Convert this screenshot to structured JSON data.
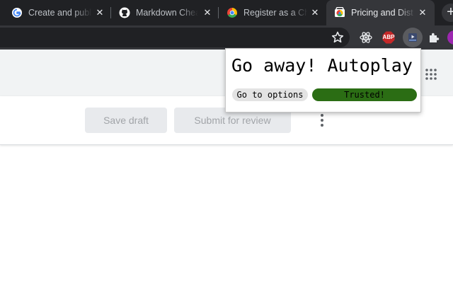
{
  "browser": {
    "tabs": [
      {
        "title": "Create and publ",
        "favicon": "google-g-icon",
        "active": false
      },
      {
        "title": "Markdown Chea",
        "favicon": "github-icon",
        "active": false
      },
      {
        "title": "Register as a Ch",
        "favicon": "chrome-icon",
        "active": false
      },
      {
        "title": "Pricing and Dist",
        "favicon": "webstore-icon",
        "active": true
      }
    ],
    "new_tab_label": "+",
    "close_label": "✕",
    "toolbar": {
      "bookmark_icon": "star-icon",
      "extensions": [
        {
          "name": "react-devtools-icon"
        },
        {
          "name": "adblock-plus-icon",
          "label": "ABP"
        },
        {
          "name": "autoplay-extension-icon"
        },
        {
          "name": "puzzle-extensions-icon"
        }
      ],
      "profile_icon": "avatar"
    }
  },
  "page": {
    "save_draft_label": "Save draft",
    "submit_label": "Submit for review",
    "more_icon": "more-vert-icon",
    "apps_icon": "apps-grid-icon"
  },
  "popup": {
    "title": "Go away! Autoplay",
    "options_label": "Go to options",
    "trusted_label": "Trusted!"
  },
  "colors": {
    "tab_strip": "#202124",
    "toolbar": "#35363a",
    "page_header": "#f1f3f4",
    "trusted_green": "#2b6d14",
    "abp_red": "#c62828"
  }
}
